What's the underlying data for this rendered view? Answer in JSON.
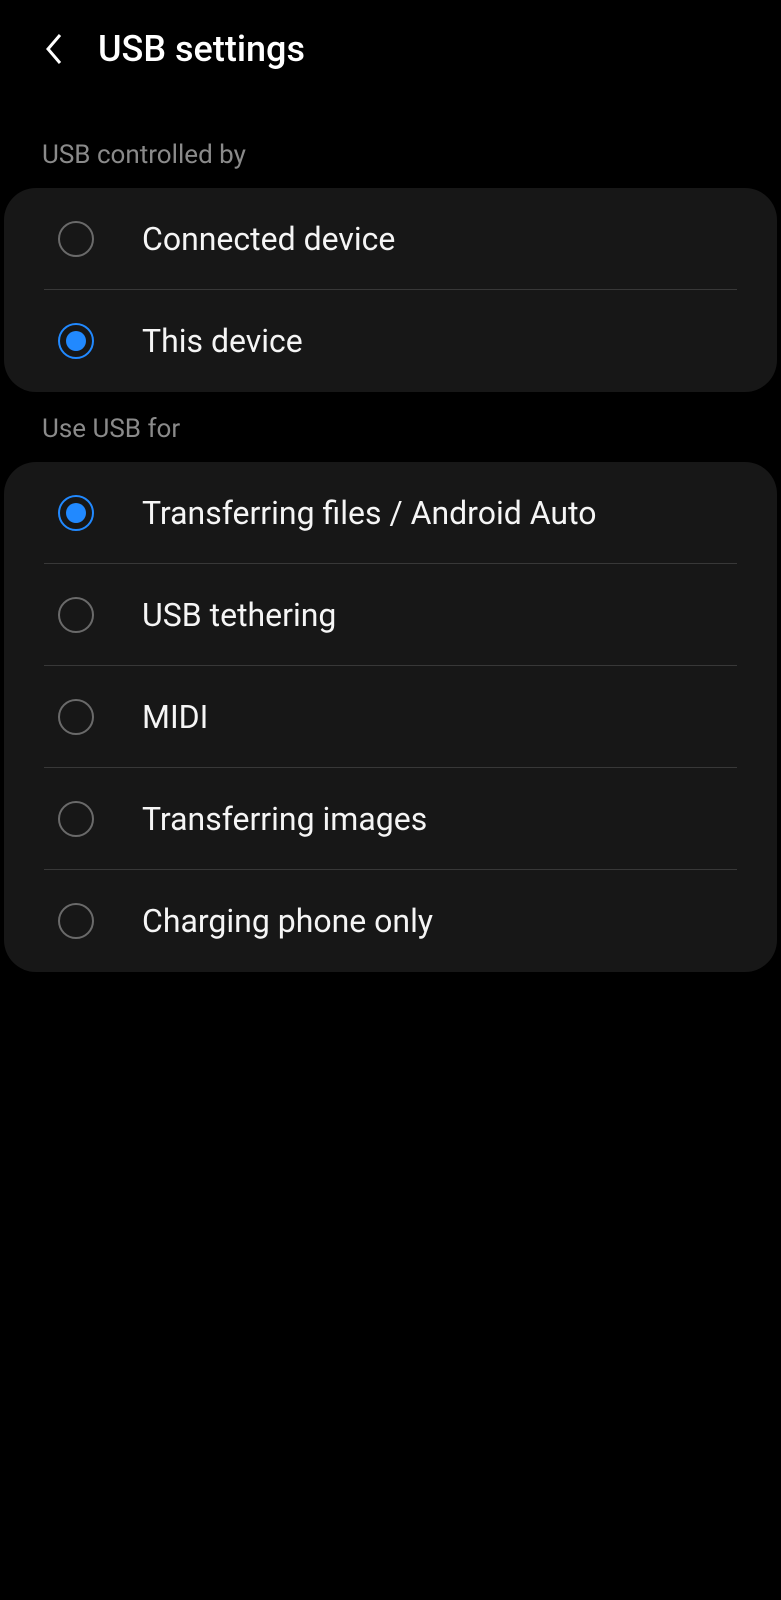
{
  "header": {
    "title": "USB settings"
  },
  "sections": {
    "controlled_by": {
      "label": "USB controlled by",
      "options": [
        {
          "label": "Connected device",
          "selected": false
        },
        {
          "label": "This device",
          "selected": true
        }
      ]
    },
    "use_for": {
      "label": "Use USB for",
      "options": [
        {
          "label": "Transferring files / Android Auto",
          "selected": true
        },
        {
          "label": "USB tethering",
          "selected": false
        },
        {
          "label": "MIDI",
          "selected": false
        },
        {
          "label": "Transferring images",
          "selected": false
        },
        {
          "label": "Charging phone only",
          "selected": false
        }
      ]
    }
  }
}
